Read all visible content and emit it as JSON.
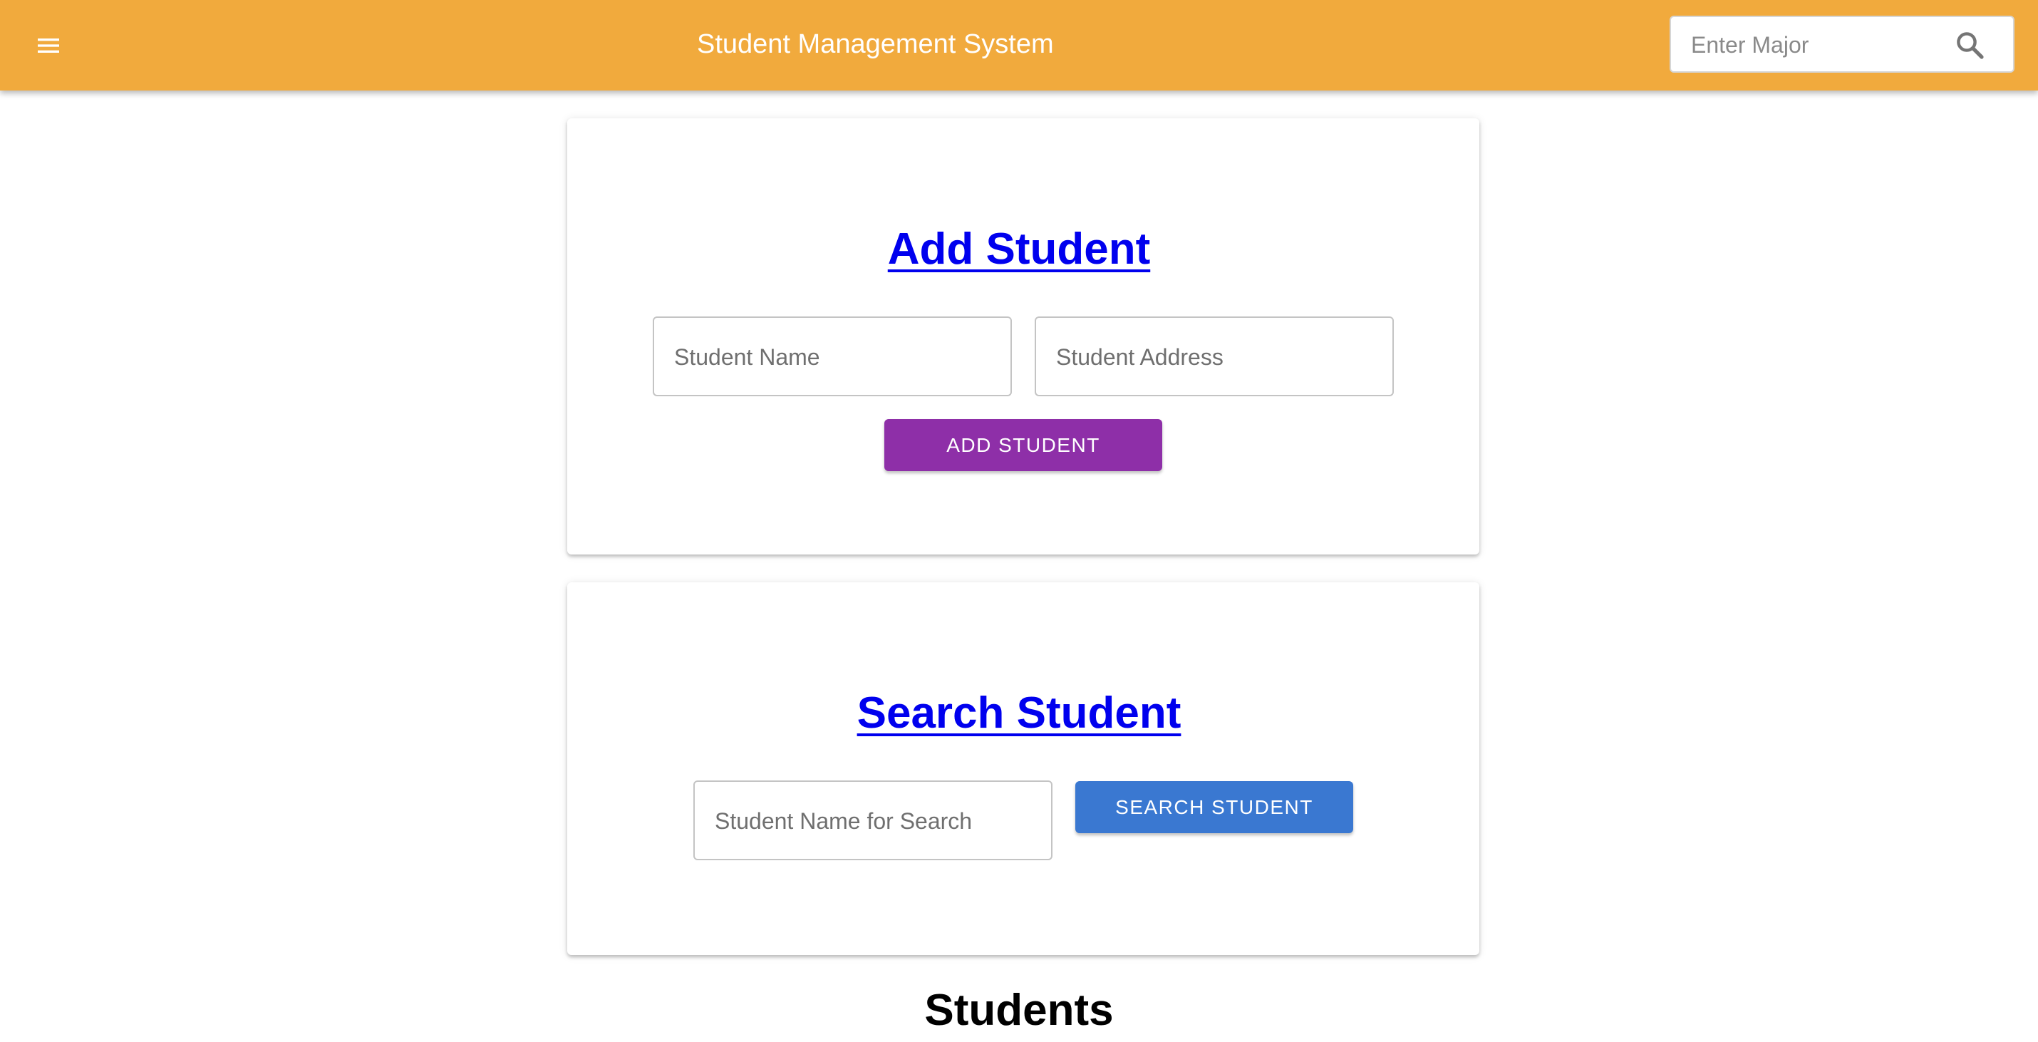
{
  "appbar": {
    "title": "Student Management System",
    "search_placeholder": "Enter Major",
    "menu_icon": "hamburger-menu-icon",
    "search_icon": "search-icon",
    "background_color": "#f1aa3d"
  },
  "add_section": {
    "heading": "Add Student",
    "name_placeholder": "Student Name",
    "address_placeholder": "Student Address",
    "button_label": "ADD STUDENT",
    "button_color": "#8e2fa8"
  },
  "search_section": {
    "heading": "Search Student",
    "name_placeholder": "Student Name for Search",
    "button_label": "SEARCH STUDENT",
    "button_color": "#3a78d1"
  },
  "students_section": {
    "title": "Students"
  }
}
